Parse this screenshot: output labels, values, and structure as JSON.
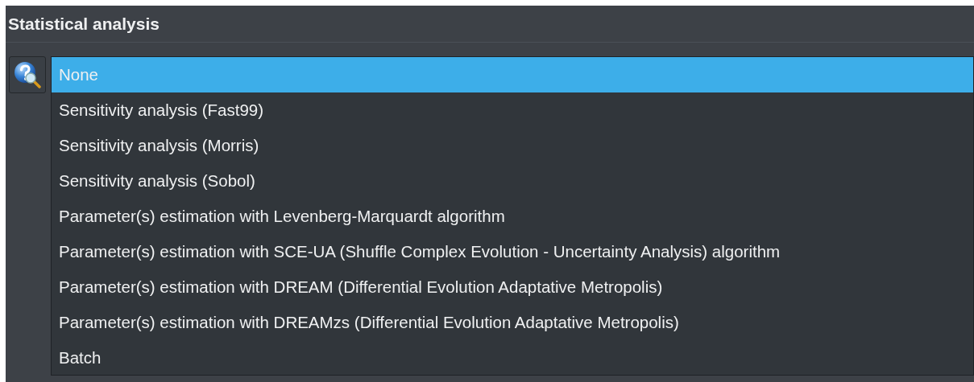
{
  "panel": {
    "title": "Statistical analysis"
  },
  "dropdown": {
    "items": [
      {
        "label": "None",
        "selected": true
      },
      {
        "label": "Sensitivity analysis (Fast99)",
        "selected": false
      },
      {
        "label": "Sensitivity analysis (Morris)",
        "selected": false
      },
      {
        "label": "Sensitivity analysis (Sobol)",
        "selected": false
      },
      {
        "label": "Parameter(s) estimation with Levenberg-Marquardt algorithm",
        "selected": false
      },
      {
        "label": "Parameter(s) estimation with SCE-UA (Shuffle Complex Evolution - Uncertainty Analysis) algorithm",
        "selected": false
      },
      {
        "label": "Parameter(s) estimation with DREAM (Differential Evolution Adaptative Metropolis)",
        "selected": false
      },
      {
        "label": "Parameter(s) estimation with DREAMzs (Differential Evolution Adaptative Metropolis)",
        "selected": false
      },
      {
        "label": "Batch",
        "selected": false
      }
    ]
  }
}
